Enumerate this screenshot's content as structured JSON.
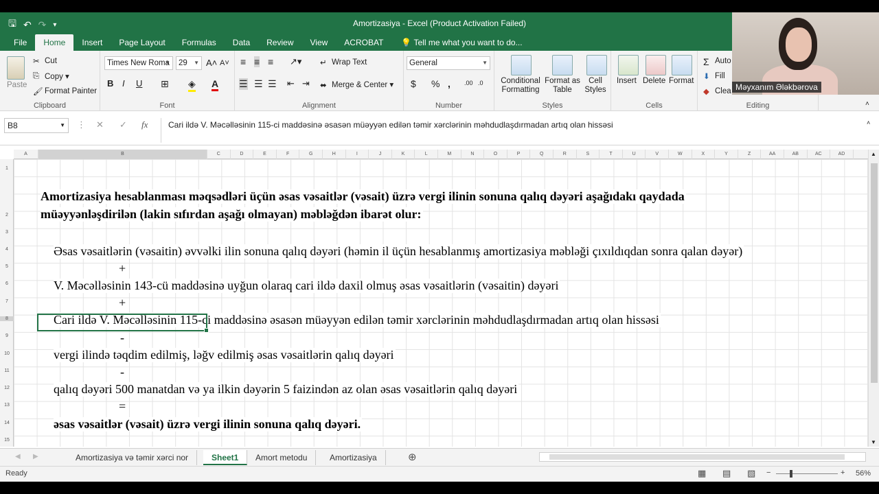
{
  "window": {
    "title": "Amortizasiya  -  Excel (Product Activation Failed)"
  },
  "menu_tabs": [
    "File",
    "Home",
    "Insert",
    "Page Layout",
    "Formulas",
    "Data",
    "Review",
    "View",
    "ACROBAT"
  ],
  "tell_me": "Tell me what you want to do...",
  "ribbon": {
    "clipboard": {
      "paste": "Paste",
      "cut": "Cut",
      "copy": "Copy",
      "format_painter": "Format Painter",
      "label": "Clipboard"
    },
    "font": {
      "name": "Times New Roma",
      "size": "29",
      "bold": "B",
      "italic": "I",
      "underline": "U",
      "label": "Font"
    },
    "alignment": {
      "wrap": "Wrap Text",
      "merge": "Merge & Center",
      "label": "Alignment"
    },
    "number": {
      "format": "General",
      "currency": "$",
      "percent": "%",
      "comma": ",",
      "label": "Number"
    },
    "styles": {
      "conditional": "Conditional Formatting",
      "format_table": "Format as Table",
      "cell_styles": "Cell Styles",
      "label": "Styles"
    },
    "cells": {
      "insert": "Insert",
      "delete": "Delete",
      "format": "Format",
      "label": "Cells"
    },
    "editing": {
      "autosum": "Auto",
      "fill": "Fill",
      "clear": "Clea",
      "label": "Editing"
    }
  },
  "formula_bar": {
    "name_box": "B8",
    "fx": "fx",
    "content": "Cari ildə V. Məcəlləsinin 115-ci maddəsinə əsasən müəyyən edilən təmir xərclərinin məhdudlaşdırmadan artıq olan hissəsi"
  },
  "columns": [
    "A",
    "B",
    "C",
    "D",
    "E",
    "F",
    "G",
    "H",
    "I",
    "J",
    "K",
    "L",
    "M",
    "N",
    "O",
    "P",
    "Q",
    "R",
    "S",
    "T",
    "U",
    "V",
    "W",
    "X",
    "Y",
    "Z",
    "AA",
    "AB",
    "AC",
    "AD"
  ],
  "rows": [
    "1",
    "2",
    "3",
    "4",
    "5",
    "6",
    "7",
    "8",
    "9",
    "10",
    "11",
    "12",
    "13",
    "14",
    "15"
  ],
  "cells": {
    "r2_line1": "Amortizasiya hesablanması məqsədləri üçün əsas vəsaitlər (vəsait) üzrə vergi ilinin sonuna qalıq dəyəri aşağıdakı qaydada",
    "r2_line2": "müəyyənləşdirilən (lakin sıfırdan aşağı olmayan) məbləğdən ibarət olur:",
    "r4": "Əsas vəsaitlərin (vəsaitin) əvvəlki ilin sonuna qalıq dəyəri (həmin il üçün hesablanmış amortizasiya məbləği çıxıldıqdan sonra qalan dəyər)",
    "r5": "+",
    "r6": "V. Məcəlləsinin 143-cü maddəsinə uyğun olaraq cari ildə daxil olmuş əsas vəsaitlərin (vəsaitin) dəyəri",
    "r7": "+",
    "r8": "Cari ildə V. Məcəlləsinin 115-ci maddəsinə əsasən müəyyən edilən təmir xərclərinin məhdudlaşdırmadan artıq olan hissəsi",
    "r9": "-",
    "r10": "vergi ilində təqdim edilmiş, ləğv edilmiş əsas vəsaitlərin qalıq dəyəri",
    "r11": "-",
    "r12": "qalıq dəyəri 500 manatdan və ya ilkin dəyərin 5 faizindən az olan əsas vəsaitlərin qalıq dəyəri",
    "r13": "=",
    "r14": "əsas vəsaitlər (vəsait) üzrə vergi ilinin sonuna qalıq dəyəri."
  },
  "sheets": [
    "Amortizasiya və təmir xərci nor",
    "Sheet1",
    "Amort metodu",
    "Amortizasiya"
  ],
  "status": {
    "ready": "Ready",
    "zoom": "56%"
  },
  "webcam": {
    "name": "Məyxanım Ələkbərova"
  },
  "colors": {
    "excel_green": "#217346",
    "ribbon_bg": "#f3f3f3"
  }
}
